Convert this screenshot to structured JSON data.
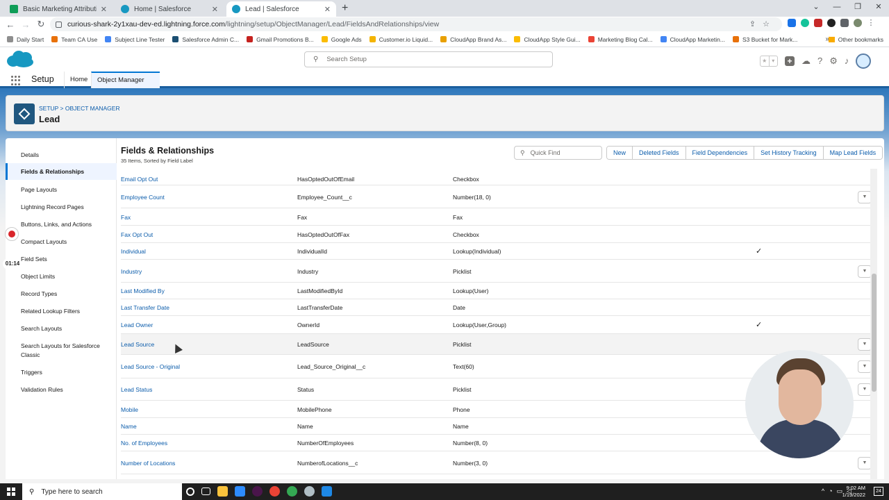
{
  "browser": {
    "tabs": [
      {
        "label": "Basic Marketing Attribution Temp",
        "favicon_color": "#0f9d58"
      },
      {
        "label": "Home | Salesforce",
        "favicon_color": "#1798c1"
      },
      {
        "label": "Lead | Salesforce",
        "favicon_color": "#1798c1"
      }
    ],
    "active_tab_index": 2,
    "url_host": "curious-shark-2y1xau-dev-ed.lightning.force.com",
    "url_path": "/lightning/setup/ObjectManager/Lead/FieldsAndRelationships/view",
    "bookmarks": [
      {
        "label": "Daily Start",
        "color": "#8e8e8e"
      },
      {
        "label": "Team CA Use",
        "color": "#e8710a"
      },
      {
        "label": "Subject Line Tester",
        "color": "#4285f4"
      },
      {
        "label": "Salesforce Admin C...",
        "color": "#1b4f72"
      },
      {
        "label": "Gmail Promotions B...",
        "color": "#c5221f"
      },
      {
        "label": "Google Ads",
        "color": "#fbbc04"
      },
      {
        "label": "Customer.io Liquid...",
        "color": "#f4b400"
      },
      {
        "label": "CloudApp Brand As...",
        "color": "#e8a000"
      },
      {
        "label": "CloudApp Style Gui...",
        "color": "#fbbc04"
      },
      {
        "label": "Marketing Blog Cal...",
        "color": "#ea4335"
      },
      {
        "label": "CloudApp Marketin...",
        "color": "#4285f4"
      },
      {
        "label": "S3 Bucket for Mark...",
        "color": "#e8710a"
      }
    ],
    "other_bookmarks": "Other bookmarks"
  },
  "header": {
    "search_placeholder": "Search Setup",
    "app_name": "Setup",
    "nav_tabs": [
      "Home",
      "Object Manager"
    ]
  },
  "object": {
    "breadcrumb": "SETUP > OBJECT MANAGER",
    "title": "Lead"
  },
  "sidebar": {
    "items": [
      "Details",
      "Fields & Relationships",
      "Page Layouts",
      "Lightning Record Pages",
      "Buttons, Links, and Actions",
      "Compact Layouts",
      "Field Sets",
      "Object Limits",
      "Record Types",
      "Related Lookup Filters",
      "Search Layouts",
      "Search Layouts for Salesforce Classic",
      "Triggers",
      "Validation Rules"
    ],
    "active_index": 1
  },
  "content": {
    "title": "Fields & Relationships",
    "subtitle": "35 Items, Sorted by Field Label",
    "quick_find_placeholder": "Quick Find",
    "buttons": [
      "New",
      "Deleted Fields",
      "Field Dependencies",
      "Set History Tracking",
      "Map Lead Fields"
    ],
    "rows": [
      {
        "label": "Email Opt Out",
        "api": "HasOptedOutOfEmail",
        "type": "Checkbox",
        "indexed": false,
        "action": false
      },
      {
        "label": "Employee Count",
        "api": "Employee_Count__c",
        "type": "Number(18, 0)",
        "indexed": false,
        "action": true
      },
      {
        "label": "Fax",
        "api": "Fax",
        "type": "Fax",
        "indexed": false,
        "action": false
      },
      {
        "label": "Fax Opt Out",
        "api": "HasOptedOutOfFax",
        "type": "Checkbox",
        "indexed": false,
        "action": false
      },
      {
        "label": "Individual",
        "api": "IndividualId",
        "type": "Lookup(Individual)",
        "indexed": true,
        "action": false
      },
      {
        "label": "Industry",
        "api": "Industry",
        "type": "Picklist",
        "indexed": false,
        "action": true
      },
      {
        "label": "Last Modified By",
        "api": "LastModifiedById",
        "type": "Lookup(User)",
        "indexed": false,
        "action": false
      },
      {
        "label": "Last Transfer Date",
        "api": "LastTransferDate",
        "type": "Date",
        "indexed": false,
        "action": false
      },
      {
        "label": "Lead Owner",
        "api": "OwnerId",
        "type": "Lookup(User,Group)",
        "indexed": true,
        "action": false
      },
      {
        "label": "Lead Source",
        "api": "LeadSource",
        "type": "Picklist",
        "indexed": false,
        "action": true
      },
      {
        "label": "Lead Source - Original",
        "api": "Lead_Source_Original__c",
        "type": "Text(60)",
        "indexed": false,
        "action": true
      },
      {
        "label": "Lead Status",
        "api": "Status",
        "type": "Picklist",
        "indexed": false,
        "action": true
      },
      {
        "label": "Mobile",
        "api": "MobilePhone",
        "type": "Phone",
        "indexed": false,
        "action": false
      },
      {
        "label": "Name",
        "api": "Name",
        "type": "Name",
        "indexed": false,
        "action": false
      },
      {
        "label": "No. of Employees",
        "api": "NumberOfEmployees",
        "type": "Number(8, 0)",
        "indexed": false,
        "action": false
      },
      {
        "label": "Number of Locations",
        "api": "NumberofLocations__c",
        "type": "Number(3, 0)",
        "indexed": false,
        "action": true
      }
    ],
    "hovered_row_index": 9,
    "checkmark_glyph": "✓",
    "row_action_glyph": "▼"
  },
  "recorder": {
    "elapsed": "01:14"
  },
  "taskbar": {
    "search_placeholder": "Type here to search",
    "time": "9:02 AM",
    "date": "1/19/2022",
    "notifications": "24"
  }
}
